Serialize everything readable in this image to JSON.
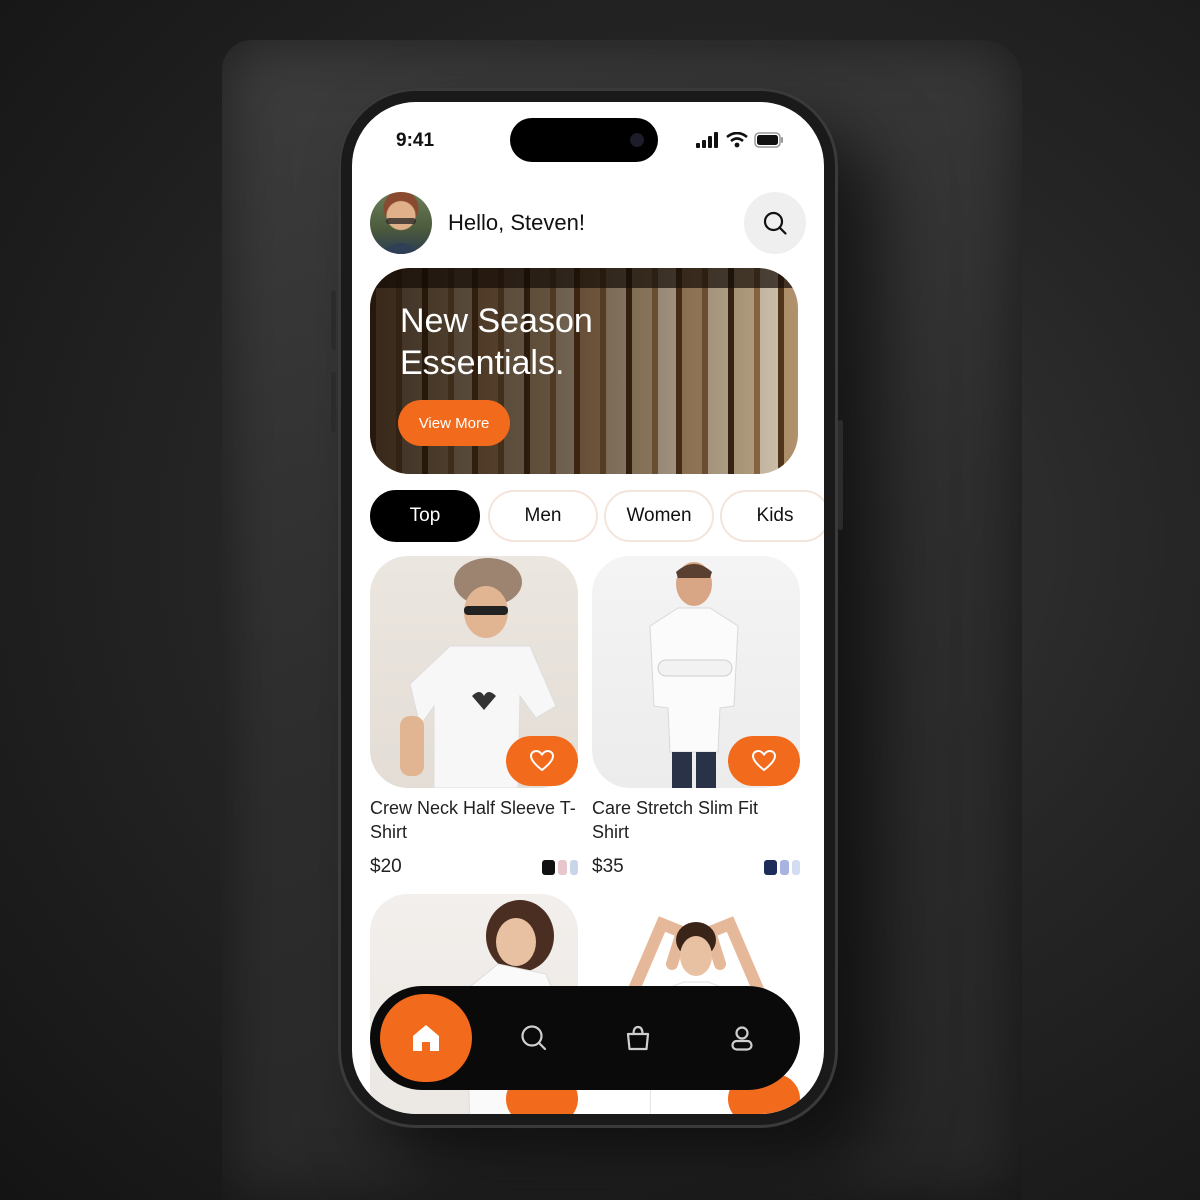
{
  "status_bar": {
    "time": "9:41"
  },
  "header": {
    "greeting": "Hello, Steven!"
  },
  "banner": {
    "title_line1": "New Season",
    "title_line2": "Essentials.",
    "cta_label": "View More"
  },
  "categories": [
    "Top",
    "Men",
    "Women",
    "Kids"
  ],
  "active_category": "Top",
  "products": [
    {
      "title": "Crew Neck Half Sleeve T-Shirt",
      "price": "$20",
      "swatches": [
        "#111111",
        "#e7c7cc",
        "#c9d6ea"
      ]
    },
    {
      "title": "Care Stretch Slim Fit Shirt",
      "price": "$35",
      "swatches": [
        "#1c2d5a",
        "#a8b4e0",
        "#d4dcf2"
      ]
    }
  ],
  "bottom_nav": [
    "home-icon",
    "search-icon",
    "bag-icon",
    "profile-icon"
  ],
  "colors": {
    "accent": "#f26a1b",
    "dark": "#0a0a0a",
    "chip_border": "#f3e4dc"
  }
}
